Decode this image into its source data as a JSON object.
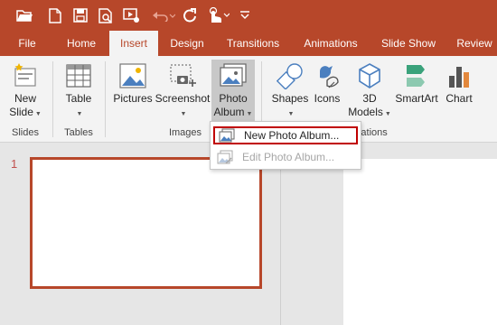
{
  "qat": {
    "icons": [
      "open-folder-icon",
      "new-file-icon",
      "save-icon",
      "print-preview-icon",
      "from-beginning-icon",
      "undo-icon",
      "redo-icon",
      "touch-mode-icon",
      "customize-icon"
    ]
  },
  "tabs": [
    {
      "label": "File"
    },
    {
      "label": "Home"
    },
    {
      "label": "Insert",
      "active": true
    },
    {
      "label": "Design"
    },
    {
      "label": "Transitions"
    },
    {
      "label": "Animations"
    },
    {
      "label": "Slide Show"
    },
    {
      "label": "Review"
    }
  ],
  "ribbon": {
    "new_slide": {
      "line1": "New",
      "line2": "Slide"
    },
    "table": {
      "label": "Table"
    },
    "pictures": {
      "label": "Pictures"
    },
    "screenshot": {
      "label": "Screenshot"
    },
    "photo_album": {
      "line1": "Photo",
      "line2": "Album"
    },
    "shapes": {
      "label": "Shapes"
    },
    "icons": {
      "label": "Icons"
    },
    "models3d": {
      "line1": "3D",
      "line2": "Models"
    },
    "smartart": {
      "label": "SmartArt"
    },
    "chart": {
      "label": "Chart"
    },
    "groups": {
      "slides": "Slides",
      "tables": "Tables",
      "images": "Images",
      "illustrations": "strations"
    }
  },
  "dropdown": {
    "items": [
      {
        "label": "New Photo Album...",
        "enabled": true
      },
      {
        "label": "Edit Photo Album...",
        "enabled": false
      }
    ]
  },
  "slides": {
    "number": "1"
  },
  "colors": {
    "accent": "#b7472a",
    "highlight": "#c00000"
  }
}
